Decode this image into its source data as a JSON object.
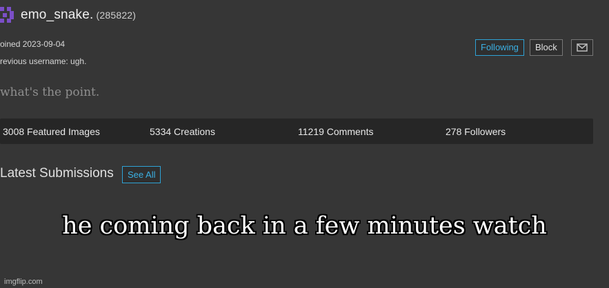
{
  "profile": {
    "username": "emo_snake.",
    "user_id": "(285822)",
    "joined": "oined 2023-09-04",
    "previous_username": "revious username: ugh.",
    "bio": "what's the point.",
    "avatar_color": "#7b4fc8"
  },
  "actions": {
    "following_label": "Following",
    "block_label": "Block",
    "mail_icon": "envelope-icon"
  },
  "stats": [
    {
      "label": "3008 Featured Images"
    },
    {
      "label": "5334 Creations"
    },
    {
      "label": "11219 Comments"
    },
    {
      "label": "278 Followers"
    }
  ],
  "latest": {
    "title": "Latest Submissions",
    "see_all_label": "See All"
  },
  "caption": "he coming back in a few minutes watch",
  "watermark": "imgflip.com",
  "colors": {
    "background": "#363636",
    "accent": "#3bb0e3",
    "stats_bar": "#262626"
  }
}
